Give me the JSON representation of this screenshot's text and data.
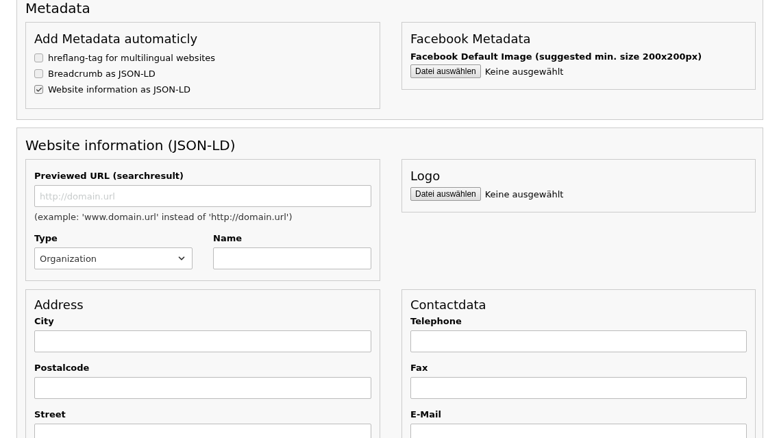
{
  "sections": [
    {
      "title": "Metadata",
      "panels": [
        {
          "kind": "checkboxes",
          "title": "Add Metadata automaticly",
          "items": [
            {
              "label": "hreflang-tag for multilingual websites",
              "checked": false
            },
            {
              "label": "Breadcrumb as JSON-LD",
              "checked": false
            },
            {
              "label": "Website information as JSON-LD",
              "checked": true
            }
          ]
        },
        {
          "kind": "file",
          "title": "Facebook Metadata",
          "label": "Facebook Default Image (suggested min. size 200x200px)",
          "button": "Datei auswählen",
          "status": "Keine ausgewählt"
        }
      ]
    },
    {
      "title": "Website information (JSON-LD)",
      "panels": [
        {
          "kind": "url",
          "label": "Previewed URL (searchresult)",
          "placeholder": "http://domain.url",
          "hint": "(example: 'www.domain.url' instead of 'http://domain.url')",
          "type_label": "Type",
          "type_value": "Organization",
          "name_label": "Name"
        },
        {
          "kind": "file",
          "title": "Logo",
          "button": "Datei auswählen",
          "status": "Keine ausgewählt"
        },
        {
          "kind": "fields",
          "title": "Address",
          "fields": [
            "City",
            "Postalcode",
            "Street"
          ]
        },
        {
          "kind": "fields",
          "title": "Contactdata",
          "fields": [
            "Telephone",
            "Fax",
            "E-Mail"
          ]
        }
      ]
    }
  ]
}
